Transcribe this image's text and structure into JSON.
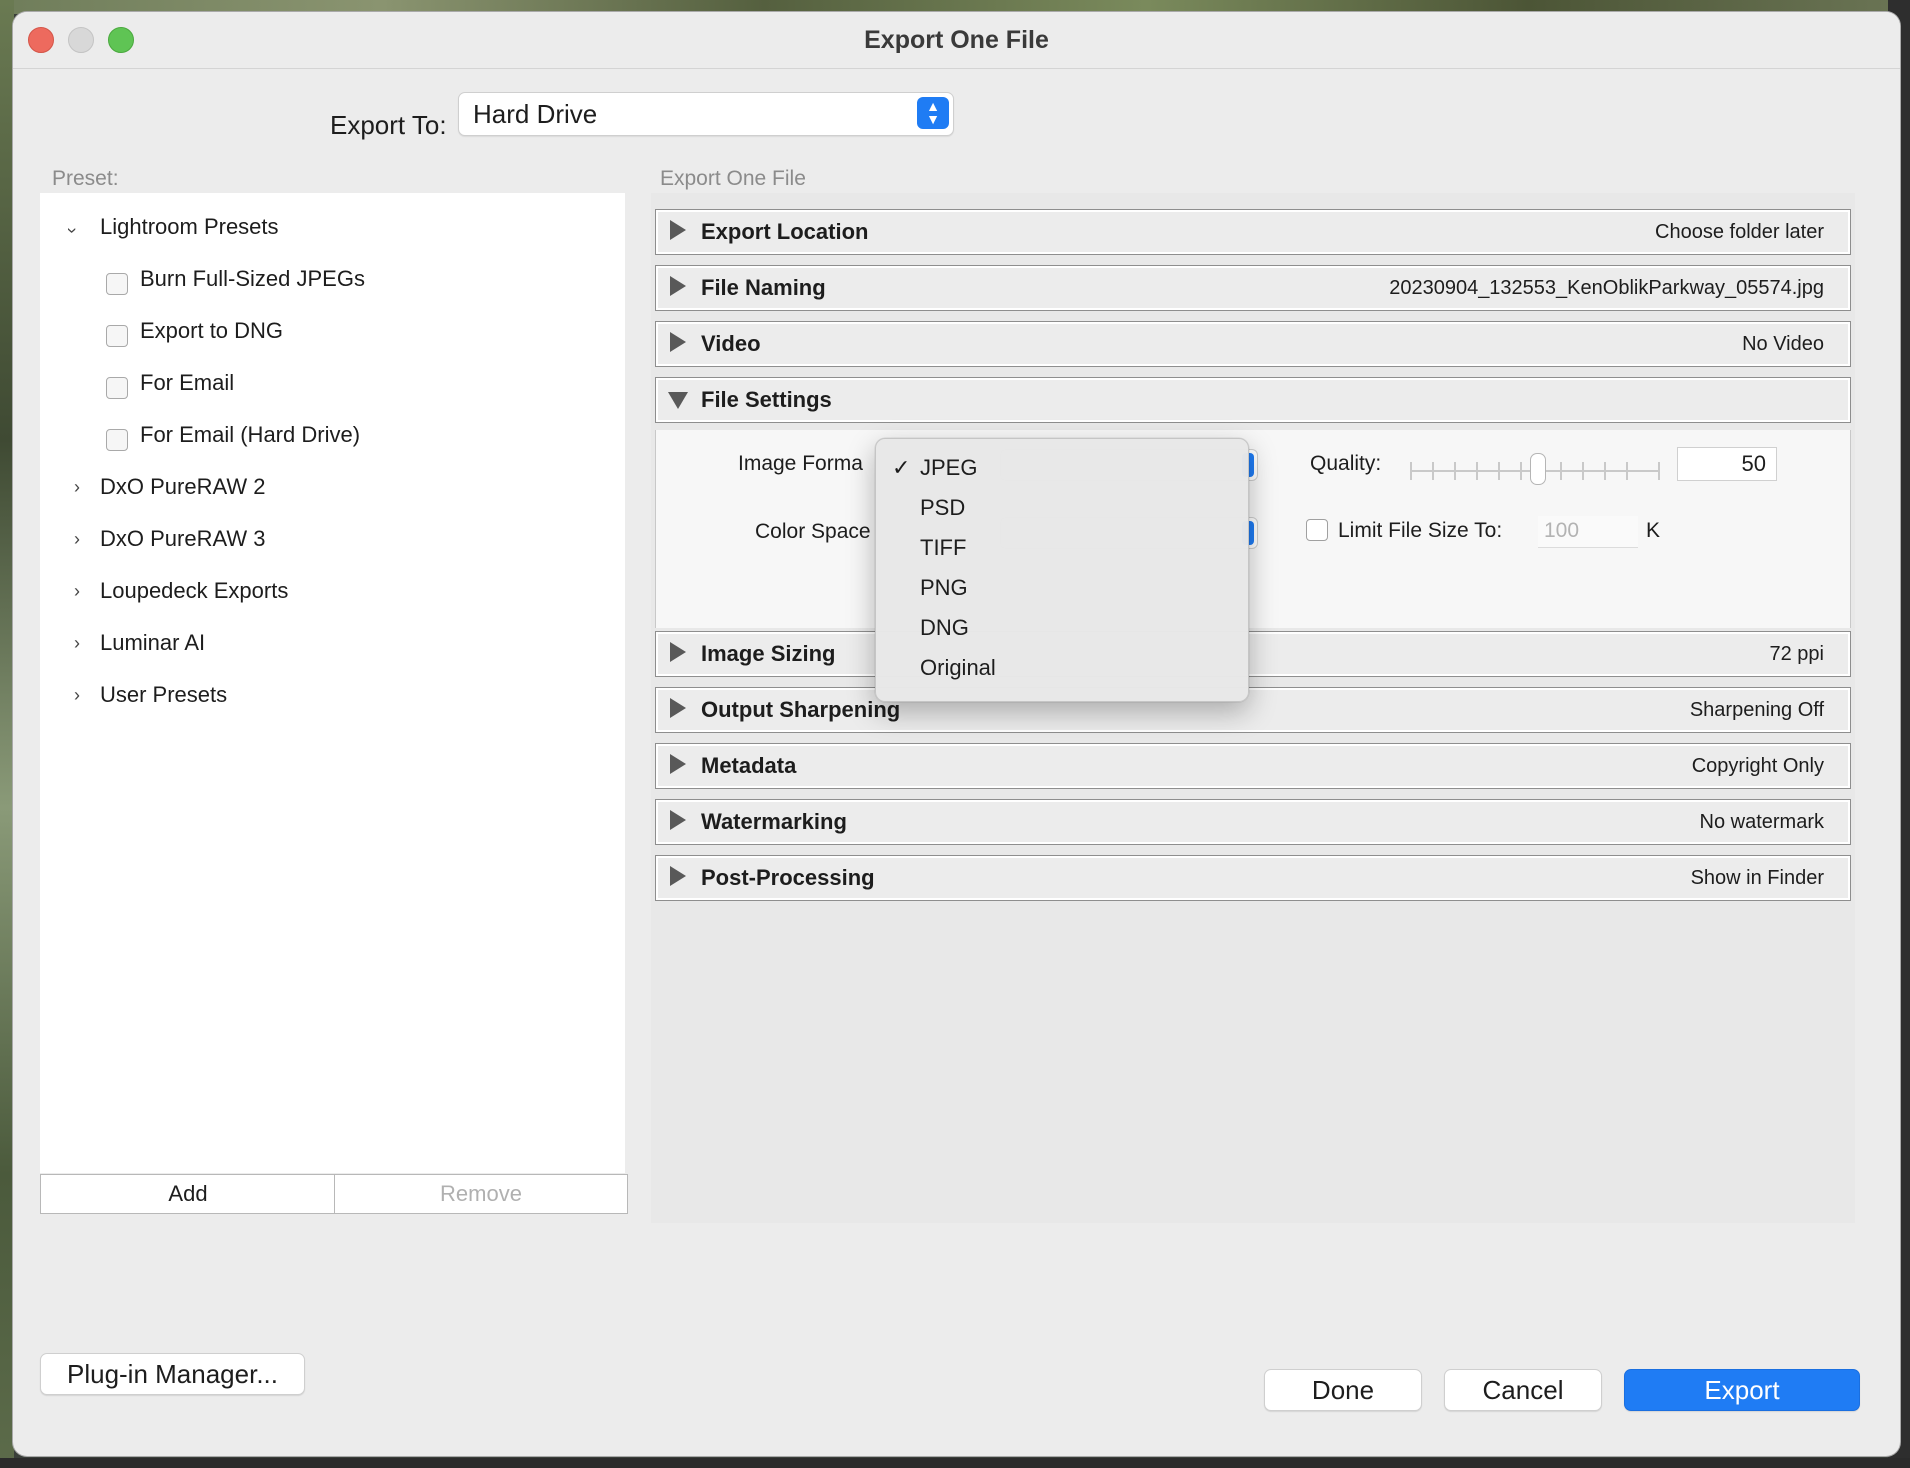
{
  "window": {
    "title": "Export One File"
  },
  "export_to": {
    "label": "Export To:",
    "value": "Hard Drive"
  },
  "presets": {
    "label": "Preset:",
    "lightroom": {
      "label": "Lightroom Presets",
      "items": [
        "Burn Full-Sized JPEGs",
        "Export to DNG",
        "For Email",
        "For Email (Hard Drive)"
      ]
    },
    "folders": [
      "DxO PureRAW 2",
      "DxO PureRAW 3",
      "Loupedeck Exports",
      "Luminar AI",
      "User Presets"
    ],
    "add_label": "Add",
    "remove_label": "Remove"
  },
  "panel_title": "Export One File",
  "sections": [
    {
      "name": "Export Location",
      "summary": "Choose folder later"
    },
    {
      "name": "File Naming",
      "summary": "20230904_132553_KenOblikParkway_05574.jpg"
    },
    {
      "name": "Video",
      "summary": "No Video"
    },
    {
      "name": "File Settings",
      "summary": ""
    },
    {
      "name": "Image Sizing",
      "summary": "72 ppi"
    },
    {
      "name": "Output Sharpening",
      "summary": "Sharpening Off"
    },
    {
      "name": "Metadata",
      "summary": "Copyright Only"
    },
    {
      "name": "Watermarking",
      "summary": "No watermark"
    },
    {
      "name": "Post-Processing",
      "summary": "Show in Finder"
    }
  ],
  "file_settings": {
    "image_format_label": "Image Forma",
    "color_space_label": "Color Space",
    "quality_label": "Quality:",
    "quality_value": "50",
    "limit_label": "Limit File Size To:",
    "limit_value": "100",
    "limit_unit": "K",
    "limit_checked": false
  },
  "format_menu": {
    "selected": "JPEG",
    "check": "✓",
    "options": [
      "JPEG",
      "PSD",
      "TIFF",
      "PNG",
      "DNG",
      "Original"
    ]
  },
  "footer": {
    "plugin_manager": "Plug-in Manager...",
    "done": "Done",
    "cancel": "Cancel",
    "export": "Export"
  },
  "colors": {
    "accent": "#1f7cf4",
    "close": "#ed6a5e",
    "maximize": "#5fc454"
  }
}
